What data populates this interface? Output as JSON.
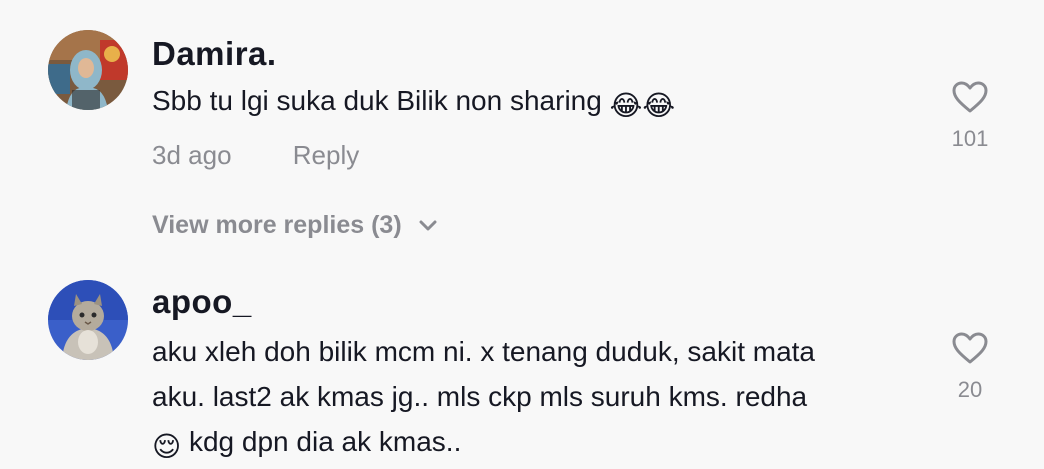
{
  "comments": [
    {
      "username": "Damira.",
      "text": "Sbb tu lgi suka duk Bilik non sharing",
      "emojis": "😂😂",
      "time": "3d ago",
      "reply_label": "Reply",
      "likes": "101",
      "avatar_icon": "user-avatar-hijab-icon"
    },
    {
      "username": "apoo_",
      "text_line1": "aku xleh doh bilik mcm ni. x tenang duduk, sakit mata",
      "text_line2": "aku. last2 ak kmas jg.. mls ckp mls suruh kms. redha",
      "emoji": "😌",
      "text_line3": "kdg dpn dia ak kmas..",
      "likes": "20",
      "avatar_icon": "user-avatar-cat-icon"
    }
  ],
  "view_more": {
    "label": "View more replies (3)"
  },
  "colors": {
    "background": "#f8f8f8",
    "primary_text": "#161823",
    "secondary_text": "#8a8b91"
  }
}
